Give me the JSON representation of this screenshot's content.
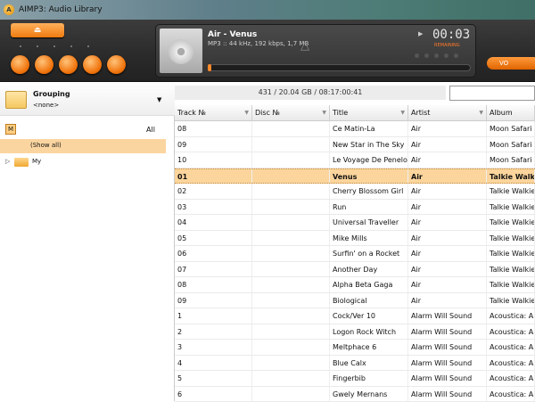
{
  "window": {
    "title": "AIMP3: Audio Library"
  },
  "player": {
    "track_title": "Air - Venus",
    "track_info": "MP3 :: 44 kHz, 192 kbps, 1,7 MB",
    "time": "00:03",
    "time_label": "REMAINING",
    "seek_position": 0.0,
    "accent_color": "#f07a10"
  },
  "left_panel": {
    "grouping_label": "Grouping",
    "grouping_value": "<none>",
    "filter_all": "All",
    "filter_icon": "M",
    "tree": {
      "show_all": "(Show all)",
      "my_folder": "My"
    }
  },
  "library": {
    "stats": "431 / 20.04 GB / 08:17:00:41",
    "search_value": "",
    "columns": [
      "Track №",
      "Disc №",
      "Title",
      "Artist",
      "Album"
    ],
    "rows": [
      {
        "track": "08",
        "disc": "",
        "title": "Ce Matin-La",
        "artist": "Air",
        "album": "Moon Safari",
        "selected": false
      },
      {
        "track": "09",
        "disc": "",
        "title": "New Star in The Sky",
        "artist": "Air",
        "album": "Moon Safari",
        "selected": false
      },
      {
        "track": "10",
        "disc": "",
        "title": "Le Voyage De Penelope",
        "artist": "Air",
        "album": "Moon Safari",
        "selected": false
      },
      {
        "track": "01",
        "disc": "",
        "title": "Venus",
        "artist": "Air",
        "album": "Talkie Walkie",
        "selected": true
      },
      {
        "track": "02",
        "disc": "",
        "title": "Cherry Blossom Girl",
        "artist": "Air",
        "album": "Talkie Walkie",
        "selected": false
      },
      {
        "track": "03",
        "disc": "",
        "title": "Run",
        "artist": "Air",
        "album": "Talkie Walkie",
        "selected": false
      },
      {
        "track": "04",
        "disc": "",
        "title": "Universal Traveller",
        "artist": "Air",
        "album": "Talkie Walkie",
        "selected": false
      },
      {
        "track": "05",
        "disc": "",
        "title": "Mike Mills",
        "artist": "Air",
        "album": "Talkie Walkie",
        "selected": false
      },
      {
        "track": "06",
        "disc": "",
        "title": "Surfin' on a Rocket",
        "artist": "Air",
        "album": "Talkie Walkie",
        "selected": false
      },
      {
        "track": "07",
        "disc": "",
        "title": "Another Day",
        "artist": "Air",
        "album": "Talkie Walkie",
        "selected": false
      },
      {
        "track": "08",
        "disc": "",
        "title": "Alpha Beta Gaga",
        "artist": "Air",
        "album": "Talkie Walkie",
        "selected": false
      },
      {
        "track": "09",
        "disc": "",
        "title": "Biological",
        "artist": "Air",
        "album": "Talkie Walkie",
        "selected": false
      },
      {
        "track": "1",
        "disc": "",
        "title": "Cock/Ver 10",
        "artist": "Alarm Will Sound",
        "album": "Acoustica: Alarm",
        "selected": false
      },
      {
        "track": "2",
        "disc": "",
        "title": "Logon Rock Witch",
        "artist": "Alarm Will Sound",
        "album": "Acoustica: Alarm",
        "selected": false
      },
      {
        "track": "3",
        "disc": "",
        "title": "Meltphace 6",
        "artist": "Alarm Will Sound",
        "album": "Acoustica: Alarm",
        "selected": false
      },
      {
        "track": "4",
        "disc": "",
        "title": "Blue Calx",
        "artist": "Alarm Will Sound",
        "album": "Acoustica: Alarm",
        "selected": false
      },
      {
        "track": "5",
        "disc": "",
        "title": "Fingerbib",
        "artist": "Alarm Will Sound",
        "album": "Acoustica: Alarm",
        "selected": false
      },
      {
        "track": "6",
        "disc": "",
        "title": "Gwely Mernans",
        "artist": "Alarm Will Sound",
        "album": "Acoustica: Alarm",
        "selected": false
      }
    ]
  }
}
